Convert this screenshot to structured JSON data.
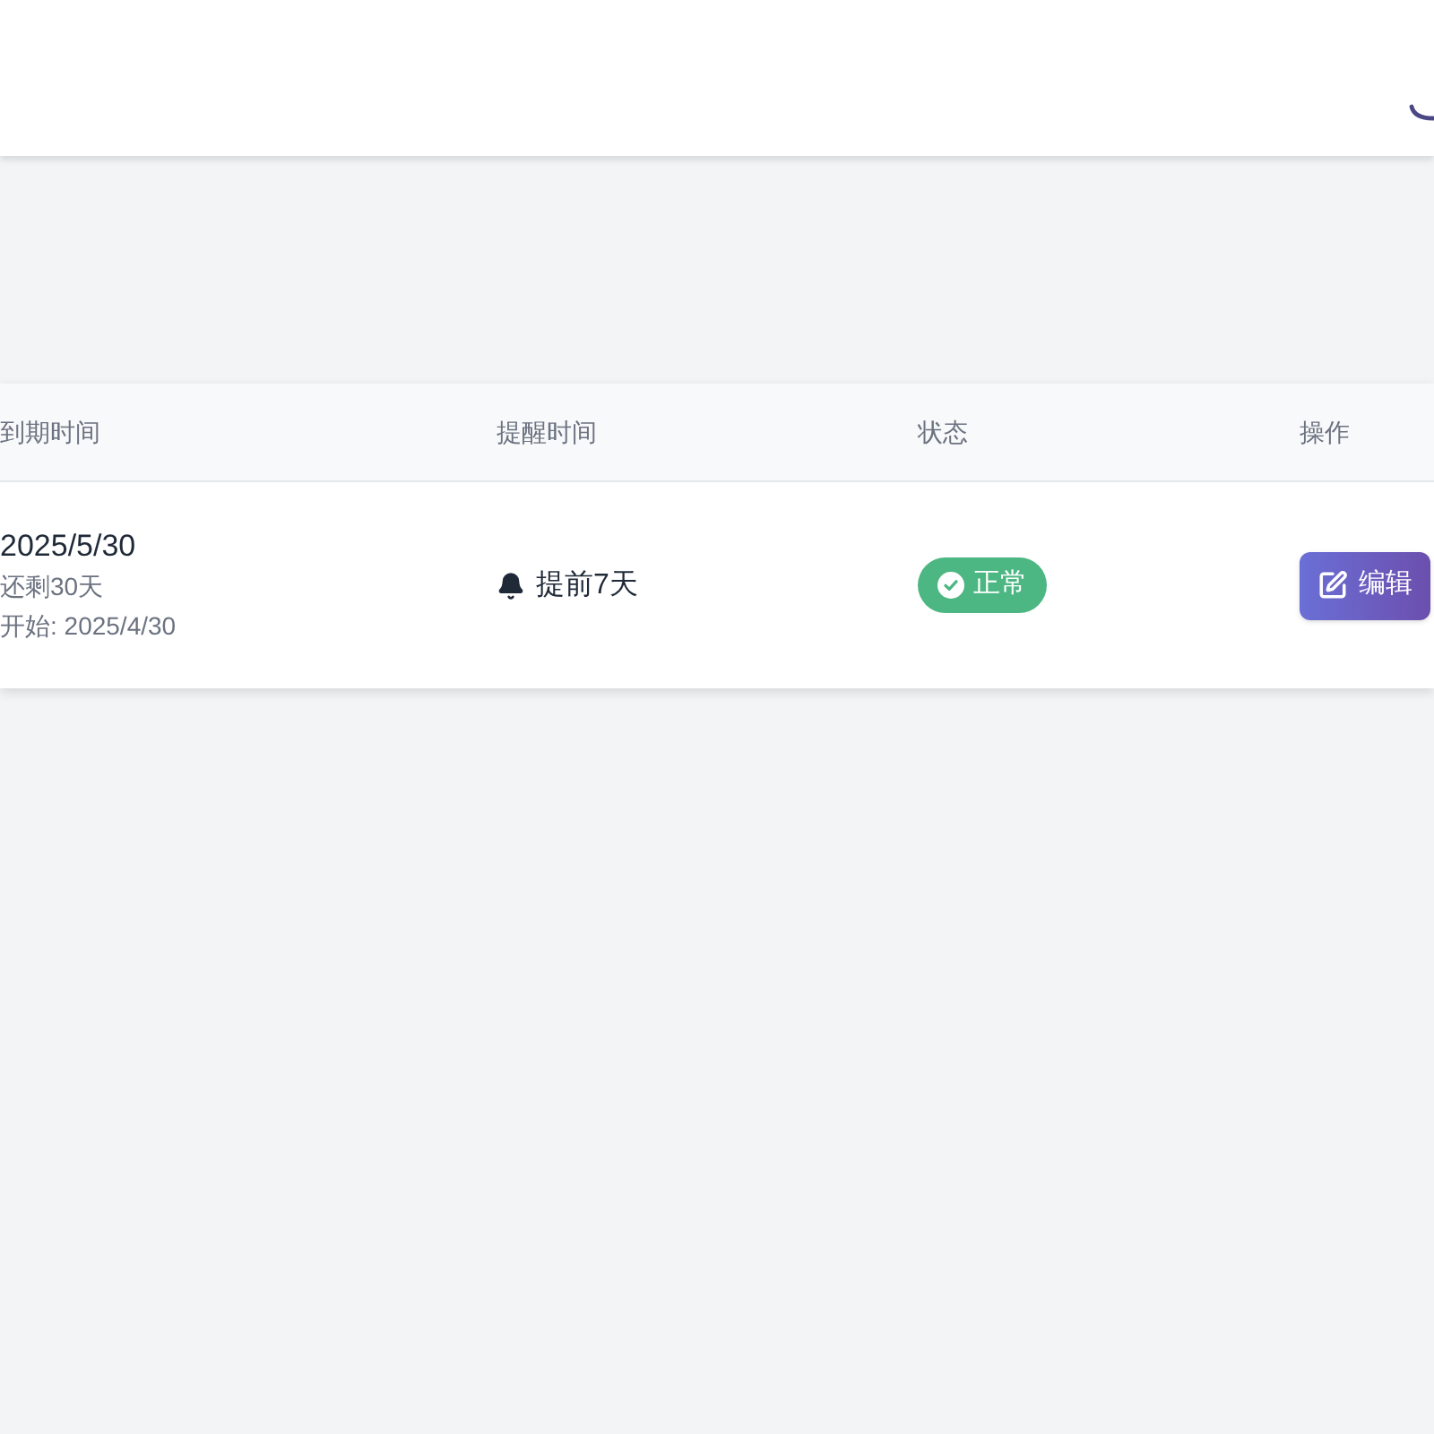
{
  "table": {
    "columns": [
      "到期时间",
      "提醒时间",
      "状态",
      "操作"
    ],
    "rows": [
      {
        "expiry_date": "2025/5/30",
        "remaining": "还剩30天",
        "start": "开始: 2025/4/30",
        "reminder": "提前7天",
        "status": {
          "label": "正常",
          "kind": "ok"
        },
        "actions": [
          {
            "label": "编辑",
            "kind": "edit"
          }
        ]
      }
    ]
  }
}
